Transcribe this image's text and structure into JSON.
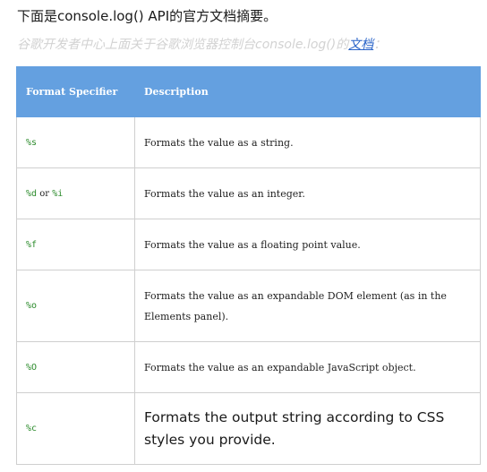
{
  "intro": "下面是console.log() API的官方文档摘要。",
  "source": {
    "prefix": "谷歌开发者中心上面关于谷歌浏览器控制台console.log()的",
    "link": "文档",
    "suffix": "："
  },
  "table": {
    "headers": [
      "Format Specifier",
      "Description"
    ],
    "rows": [
      {
        "spec": "%s",
        "desc": "Formats the value as a string."
      },
      {
        "spec": "%d",
        "joiner": " or ",
        "spec2": "%i",
        "desc": "Formats the value as an integer."
      },
      {
        "spec": "%f",
        "desc": "Formats the value as a floating point value."
      },
      {
        "spec": "%o",
        "desc": "Formats the value as an expandable DOM element (as in the Elements panel)."
      },
      {
        "spec": "%O",
        "desc": "Formats the value as an expandable JavaScript object."
      },
      {
        "spec": "%c",
        "desc": "Formats the output string according to CSS styles you provide."
      }
    ]
  }
}
